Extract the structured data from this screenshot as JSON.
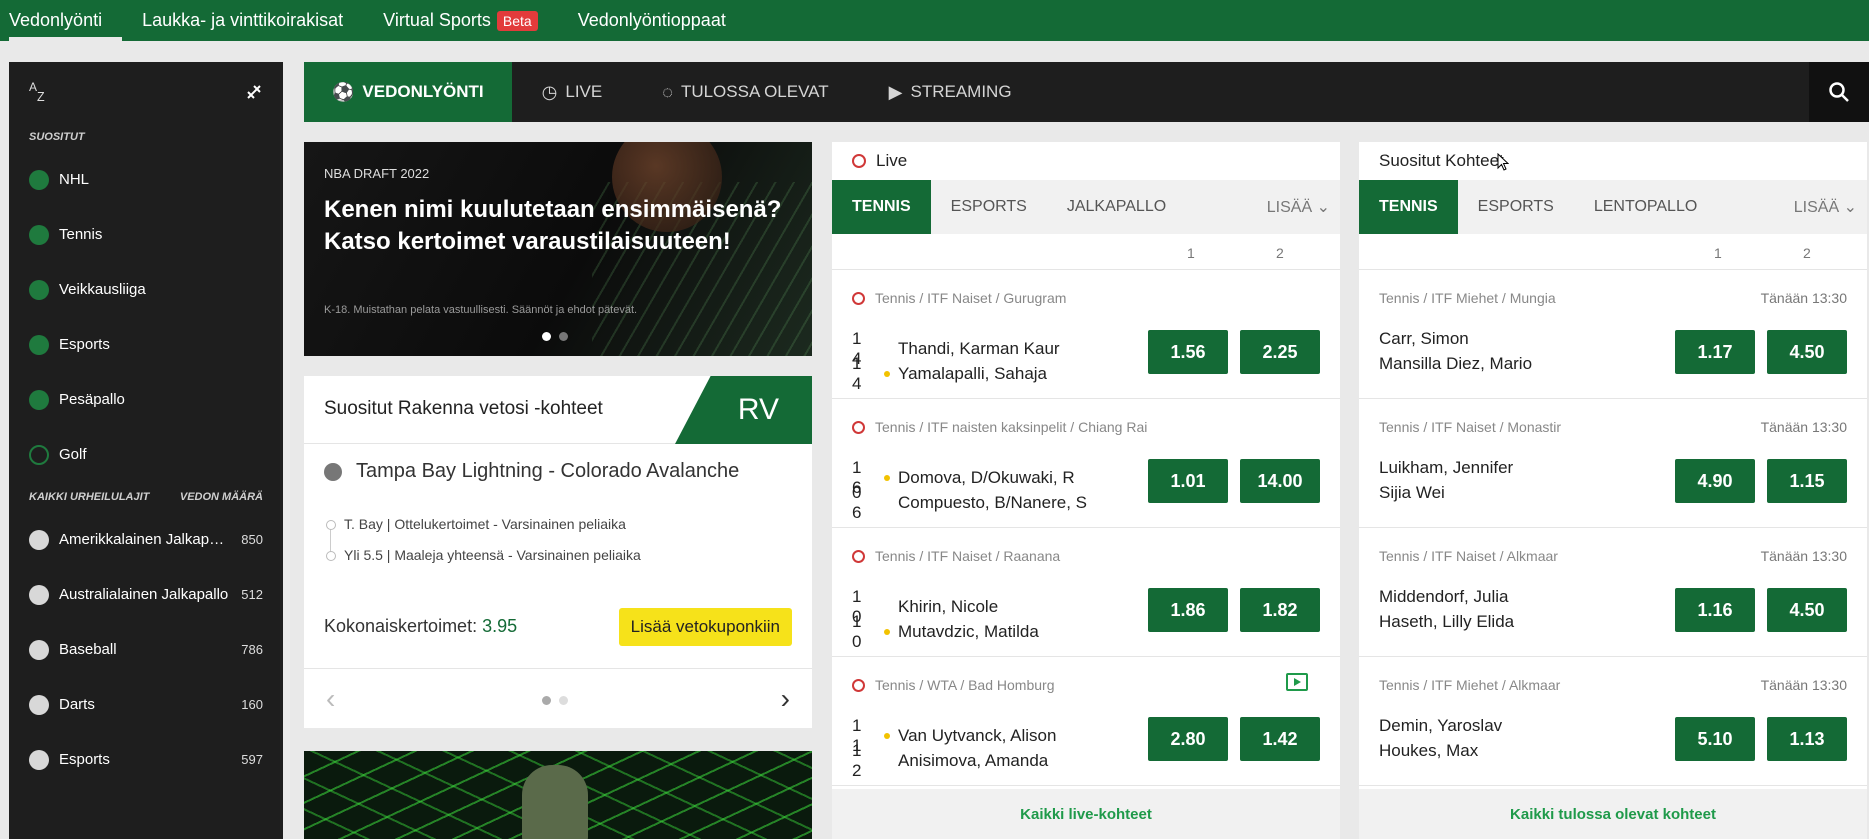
{
  "topnav": {
    "items": [
      {
        "label": "Vedonlyönti",
        "active": true
      },
      {
        "label": "Laukka- ja vinttikoirakisat"
      },
      {
        "label": "Virtual Sports",
        "badge": "Beta"
      },
      {
        "label": "Vedonlyöntioppaat"
      }
    ]
  },
  "sidebar": {
    "az": "A",
    "az_sub": "Z",
    "section_popular": "SUOSITUT",
    "popular": [
      {
        "label": "NHL",
        "icon": "hockey-puck-icon"
      },
      {
        "label": "Tennis",
        "icon": "tennis-ball-icon"
      },
      {
        "label": "Veikkausliiga",
        "icon": "football-icon"
      },
      {
        "label": "Esports",
        "icon": "gamepad-icon"
      },
      {
        "label": "Pesäpallo",
        "icon": "baseball-icon"
      },
      {
        "label": "Golf",
        "icon": "golf-icon"
      }
    ],
    "section_all": "KAIKKI URHEILULAJIT",
    "section_count": "VEDON MÄÄRÄ",
    "all": [
      {
        "label": "Amerikkalainen Jalkapallo",
        "count": "850"
      },
      {
        "label": "Australialainen Jalkapallo",
        "count": "512"
      },
      {
        "label": "Baseball",
        "count": "786"
      },
      {
        "label": "Darts",
        "count": "160"
      },
      {
        "label": "Esports",
        "count": "597"
      }
    ]
  },
  "subnav": {
    "tabs": [
      {
        "label": "VEDONLYÖNTI",
        "active": true
      },
      {
        "label": "LIVE"
      },
      {
        "label": "TULOSSA OLEVAT"
      },
      {
        "label": "STREAMING"
      }
    ]
  },
  "banner": {
    "kicker": "NBA DRAFT 2022",
    "title": "Kenen nimi kuulutetaan ensimmäisenä? Katso kertoimet varaustilaisuuteen!",
    "fine": "K-18. Muistathan pelata vastuullisesti. Säännöt ja ehdot pätevät."
  },
  "rv": {
    "title": "Suositut Rakenna vetosi -kohteet",
    "badge": "RV",
    "match": "Tampa Bay Lightning - Colorado Avalanche",
    "selections": [
      "T. Bay | Ottelukertoimet - Varsinainen peliaika",
      "Yli 5.5 | Maaleja yhteensä - Varsinainen peliaika"
    ],
    "total_label": "Kokonaiskertoimet:",
    "total_value": "3.95",
    "add_button": "Lisää vetokuponkiin"
  },
  "live": {
    "title": "Live",
    "tabs": [
      "TENNIS",
      "ESPORTS",
      "JALKAPALLO"
    ],
    "more": "LISÄÄ",
    "col1": "1",
    "col2": "2",
    "events": [
      {
        "comp": "Tennis / ITF Naiset / Gurugram",
        "p1": "Thandi, Karman Kaur",
        "p2": "Yamalapalli, Sahaja",
        "s1": "1 4",
        "s2": "1 4",
        "serve": 2,
        "o1": "1.56",
        "o2": "2.25"
      },
      {
        "comp": "Tennis / ITF naisten kaksinpelit / Chiang Rai",
        "p1": "Domova, D/Okuwaki, R",
        "p2": "Compuesto, B/Nanere, S",
        "s1": "1 6",
        "s2": "0 6",
        "serve": 1,
        "o1": "1.01",
        "o2": "14.00"
      },
      {
        "comp": "Tennis / ITF Naiset / Raanana",
        "p1": "Khirin, Nicole",
        "p2": "Mutavdzic, Matilda",
        "s1": "1 0",
        "s2": "1 0",
        "serve": 2,
        "o1": "1.86",
        "o2": "1.82"
      },
      {
        "comp": "Tennis / WTA / Bad Homburg",
        "p1": "Van Uytvanck, Alison",
        "p2": "Anisimova, Amanda",
        "s1": "1 1",
        "s2": "1 2",
        "serve": 1,
        "o1": "2.80",
        "o2": "1.42",
        "stream": true
      }
    ],
    "footer": "Kaikki live-kohteet"
  },
  "popular": {
    "title": "Suositut Kohteet",
    "tabs": [
      "TENNIS",
      "ESPORTS",
      "LENTOPALLO"
    ],
    "more": "LISÄÄ",
    "col1": "1",
    "col2": "2",
    "events": [
      {
        "comp": "Tennis / ITF Miehet / Mungia",
        "time": "Tänään 13:30",
        "p1": "Carr, Simon",
        "p2": "Mansilla Diez, Mario",
        "o1": "1.17",
        "o2": "4.50"
      },
      {
        "comp": "Tennis / ITF Naiset / Monastir",
        "time": "Tänään 13:30",
        "p1": "Luikham, Jennifer",
        "p2": "Sijia Wei",
        "o1": "4.90",
        "o2": "1.15"
      },
      {
        "comp": "Tennis / ITF Naiset / Alkmaar",
        "time": "Tänään 13:30",
        "p1": "Middendorf, Julia",
        "p2": "Haseth, Lilly Elida",
        "o1": "1.16",
        "o2": "4.50"
      },
      {
        "comp": "Tennis / ITF Miehet / Alkmaar",
        "time": "Tänään 13:30",
        "p1": "Demin, Yaroslav",
        "p2": "Houkes, Max",
        "o1": "5.10",
        "o2": "1.13"
      }
    ],
    "footer": "Kaikki tulossa olevat kohteet"
  },
  "colors": {
    "brand_green": "#146a36",
    "accent_yellow": "#f6e21a",
    "live_red": "#d03838"
  }
}
